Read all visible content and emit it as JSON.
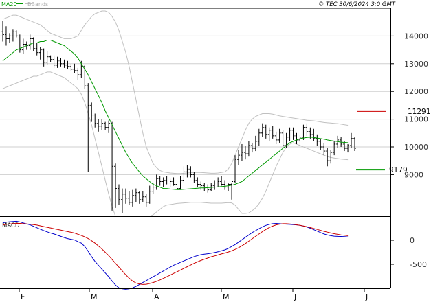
{
  "header": {
    "legend": [
      {
        "label": "MA20",
        "color": "#009900"
      },
      {
        "label": "BBands",
        "color": "#c0c0c0"
      }
    ],
    "copyright": "© TEC 30/6/2024 3:0 GMT"
  },
  "chart_data": [
    {
      "type": "ohlc",
      "ylim": [
        7500,
        15000
      ],
      "yticks": [
        9000,
        10000,
        11000,
        12000,
        13000,
        14000
      ],
      "ytick_labels": [
        "9000",
        "10000",
        "11000",
        "12000",
        "13000",
        "14000"
      ],
      "grid": true,
      "x_months": [
        "F",
        "M",
        "A",
        "M",
        "J",
        "J"
      ],
      "levels": [
        {
          "label": "11291",
          "value": 11291,
          "color": "#cc0000"
        },
        {
          "label": "9179",
          "value": 9179,
          "color": "#009900"
        }
      ],
      "ohlc": [
        [
          14150,
          14550,
          13800,
          14050
        ],
        [
          14050,
          14350,
          13650,
          13900
        ],
        [
          13900,
          14100,
          13750,
          14000
        ],
        [
          14000,
          14250,
          13800,
          14150
        ],
        [
          14150,
          14200,
          13950,
          14000
        ],
        [
          14000,
          14050,
          13400,
          13500
        ],
        [
          13500,
          13900,
          13350,
          13700
        ],
        [
          13700,
          13800,
          13500,
          13650
        ],
        [
          13650,
          14050,
          13500,
          13900
        ],
        [
          13900,
          13950,
          13450,
          13550
        ],
        [
          13550,
          13750,
          13300,
          13400
        ],
        [
          13400,
          13600,
          13150,
          13500
        ],
        [
          13500,
          13550,
          12900,
          13050
        ],
        [
          13050,
          13450,
          12950,
          13250
        ],
        [
          13250,
          13300,
          13050,
          13150
        ],
        [
          13150,
          13300,
          12850,
          12950
        ],
        [
          12950,
          13250,
          12850,
          13100
        ],
        [
          13100,
          13200,
          12900,
          13000
        ],
        [
          13000,
          13150,
          12850,
          12950
        ],
        [
          12950,
          13100,
          12800,
          12900
        ],
        [
          12900,
          13000,
          12750,
          12800
        ],
        [
          12800,
          13000,
          12650,
          12750
        ],
        [
          12750,
          12850,
          12400,
          12600
        ],
        [
          12600,
          13100,
          12500,
          12900
        ],
        [
          12900,
          12950,
          12100,
          12200
        ],
        [
          12200,
          12300,
          9100,
          11500
        ],
        [
          11500,
          11600,
          10900,
          11150
        ],
        [
          11150,
          11200,
          10700,
          10850
        ],
        [
          10850,
          11000,
          10550,
          10750
        ],
        [
          10750,
          11000,
          10600,
          10850
        ],
        [
          10850,
          10900,
          10600,
          10700
        ],
        [
          10700,
          10950,
          10500,
          10850
        ],
        [
          10850,
          10900,
          7700,
          9300
        ],
        [
          9300,
          9400,
          7800,
          8500
        ],
        [
          8500,
          8650,
          7900,
          8100
        ],
        [
          8100,
          8500,
          7600,
          8300
        ],
        [
          8300,
          8500,
          7950,
          8150
        ],
        [
          8150,
          8400,
          7900,
          8000
        ],
        [
          8000,
          8450,
          7850,
          8250
        ],
        [
          8250,
          8500,
          8000,
          8350
        ],
        [
          8350,
          8400,
          7950,
          8100
        ],
        [
          8100,
          8400,
          8000,
          8200
        ],
        [
          8200,
          8300,
          7850,
          8000
        ],
        [
          8000,
          8600,
          7950,
          8400
        ],
        [
          8400,
          8700,
          8300,
          8550
        ],
        [
          8550,
          9000,
          8450,
          8850
        ],
        [
          8850,
          8950,
          8600,
          8750
        ],
        [
          8750,
          8900,
          8550,
          8800
        ],
        [
          8800,
          8950,
          8650,
          8700
        ],
        [
          8700,
          8850,
          8550,
          8750
        ],
        [
          8750,
          8900,
          8600,
          8650
        ],
        [
          8650,
          8800,
          8400,
          8500
        ],
        [
          8500,
          8950,
          8450,
          8800
        ],
        [
          8800,
          9300,
          8700,
          9100
        ],
        [
          9100,
          9350,
          8900,
          9200
        ],
        [
          9200,
          9300,
          8900,
          9000
        ],
        [
          9000,
          9100,
          8700,
          8800
        ],
        [
          8800,
          8900,
          8550,
          8650
        ],
        [
          8650,
          8750,
          8450,
          8600
        ],
        [
          8600,
          8700,
          8400,
          8550
        ],
        [
          8550,
          8650,
          8350,
          8450
        ],
        [
          8450,
          8700,
          8400,
          8600
        ],
        [
          8600,
          8800,
          8450,
          8700
        ],
        [
          8700,
          8900,
          8550,
          8750
        ],
        [
          8750,
          8950,
          8600,
          8650
        ],
        [
          8650,
          8800,
          8450,
          8550
        ],
        [
          8550,
          8700,
          8400,
          8650
        ],
        [
          8650,
          8700,
          8100,
          8750
        ],
        [
          8750,
          9700,
          8700,
          9550
        ],
        [
          9550,
          9900,
          9350,
          9700
        ],
        [
          9700,
          10100,
          9500,
          9800
        ],
        [
          9800,
          10050,
          9550,
          9750
        ],
        [
          9750,
          10200,
          9650,
          10050
        ],
        [
          10050,
          10150,
          9800,
          9950
        ],
        [
          9950,
          10400,
          9850,
          10200
        ],
        [
          10200,
          10650,
          10050,
          10500
        ],
        [
          10500,
          10850,
          10350,
          10700
        ],
        [
          10700,
          10800,
          10300,
          10450
        ],
        [
          10450,
          10700,
          10200,
          10600
        ],
        [
          10600,
          10750,
          10300,
          10400
        ],
        [
          10400,
          10550,
          10100,
          10250
        ],
        [
          10250,
          10650,
          10150,
          10500
        ],
        [
          10500,
          10600,
          9950,
          10050
        ],
        [
          10050,
          10500,
          9950,
          10350
        ],
        [
          10350,
          10700,
          10200,
          10600
        ],
        [
          10600,
          10700,
          10250,
          10400
        ],
        [
          10400,
          10500,
          10100,
          10250
        ],
        [
          10250,
          10450,
          10050,
          10350
        ],
        [
          10350,
          10800,
          10250,
          10700
        ],
        [
          10700,
          10850,
          10400,
          10550
        ],
        [
          10550,
          10700,
          10300,
          10450
        ],
        [
          10450,
          10650,
          10200,
          10300
        ],
        [
          10300,
          10450,
          10050,
          10200
        ],
        [
          10200,
          10300,
          9900,
          10000
        ],
        [
          10000,
          10150,
          9700,
          9850
        ],
        [
          9850,
          9950,
          9300,
          9500
        ],
        [
          9500,
          9900,
          9400,
          9800
        ],
        [
          9800,
          10200,
          9700,
          10100
        ],
        [
          10100,
          10400,
          9950,
          10250
        ],
        [
          10250,
          10350,
          10000,
          10100
        ],
        [
          10100,
          10200,
          9850,
          9950
        ],
        [
          9950,
          10100,
          9800,
          10050
        ],
        [
          10050,
          10500,
          9950,
          10300
        ],
        [
          10300,
          10350,
          9850,
          9950
        ]
      ],
      "ma20": [
        13100,
        13200,
        13300,
        13400,
        13500,
        13550,
        13600,
        13650,
        13700,
        13750,
        13750,
        13800,
        13800,
        13850,
        13850,
        13800,
        13750,
        13700,
        13650,
        13550,
        13450,
        13350,
        13200,
        13000,
        12800,
        12600,
        12350,
        12100,
        11850,
        11600,
        11300,
        11050,
        10800,
        10550,
        10300,
        10050,
        9800,
        9600,
        9400,
        9250,
        9100,
        8950,
        8850,
        8750,
        8650,
        8600,
        8550,
        8500,
        8500,
        8480,
        8470,
        8460,
        8460,
        8470,
        8480,
        8490,
        8500,
        8510,
        8520,
        8520,
        8530,
        8540,
        8550,
        8560,
        8570,
        8580,
        8600,
        8620,
        8650,
        8700,
        8750,
        8850,
        8950,
        9050,
        9150,
        9250,
        9350,
        9450,
        9550,
        9650,
        9750,
        9850,
        9950,
        10050,
        10150,
        10200,
        10250,
        10300,
        10320,
        10340,
        10350,
        10340,
        10320,
        10300,
        10280,
        10250,
        10230,
        10210,
        10190,
        10170,
        10160,
        10150
      ],
      "bb_upper": [
        14600,
        14650,
        14700,
        14750,
        14750,
        14700,
        14650,
        14600,
        14550,
        14500,
        14450,
        14400,
        14300,
        14200,
        14100,
        14050,
        14000,
        13950,
        13900,
        13900,
        13900,
        13950,
        14000,
        14200,
        14400,
        14550,
        14700,
        14800,
        14850,
        14900,
        14900,
        14850,
        14700,
        14500,
        14200,
        13800,
        13400,
        12900,
        12300,
        11700,
        11100,
        10500,
        10000,
        9700,
        9400,
        9250,
        9150,
        9100,
        9080,
        9060,
        9050,
        9040,
        9040,
        9050,
        9060,
        9070,
        9080,
        9080,
        9080,
        9070,
        9060,
        9050,
        9050,
        9060,
        9080,
        9100,
        9200,
        9400,
        9700,
        10000,
        10300,
        10600,
        10850,
        11000,
        11100,
        11150,
        11200,
        11200,
        11200,
        11180,
        11150,
        11120,
        11100,
        11080,
        11060,
        11040,
        11020,
        11000,
        10980,
        10960,
        10950,
        10940,
        10920,
        10900,
        10880,
        10870,
        10860,
        10850,
        10840,
        10820,
        10800,
        10780
      ],
      "bb_lower": [
        12100,
        12150,
        12200,
        12250,
        12300,
        12350,
        12400,
        12450,
        12500,
        12550,
        12550,
        12600,
        12650,
        12700,
        12700,
        12650,
        12600,
        12550,
        12500,
        12400,
        12300,
        12200,
        12100,
        11900,
        11600,
        11200,
        10800,
        10300,
        9800,
        9300,
        8800,
        8300,
        7850,
        7500,
        7500,
        7500,
        7500,
        7500,
        7500,
        7500,
        7500,
        7500,
        7500,
        7500,
        7550,
        7650,
        7750,
        7850,
        7900,
        7920,
        7940,
        7960,
        7970,
        7980,
        7990,
        8000,
        8000,
        8000,
        8000,
        7990,
        7980,
        7970,
        7970,
        7970,
        7970,
        7980,
        7990,
        7980,
        7900,
        7750,
        7600,
        7600,
        7620,
        7700,
        7800,
        7950,
        8150,
        8400,
        8700,
        9000,
        9300,
        9550,
        9800,
        10000,
        10100,
        10150,
        10100,
        10050,
        10000,
        9950,
        9900,
        9850,
        9800,
        9750,
        9700,
        9650,
        9620,
        9600,
        9580,
        9560,
        9550,
        9540
      ]
    },
    {
      "type": "line",
      "title": "MACD",
      "ylim": [
        -1000,
        500
      ],
      "yticks": [
        0,
        -500
      ],
      "ytick_labels": [
        "0",
        "-500"
      ],
      "series": [
        {
          "color": "#0000cc",
          "values": [
            360,
            375,
            385,
            390,
            395,
            380,
            360,
            340,
            320,
            290,
            260,
            230,
            200,
            175,
            150,
            130,
            105,
            80,
            55,
            35,
            20,
            5,
            -30,
            -60,
            -130,
            -230,
            -340,
            -440,
            -520,
            -600,
            -680,
            -760,
            -850,
            -930,
            -990,
            -1010,
            -1020,
            -1010,
            -990,
            -960,
            -920,
            -880,
            -840,
            -800,
            -760,
            -720,
            -680,
            -640,
            -600,
            -560,
            -520,
            -490,
            -460,
            -430,
            -400,
            -370,
            -340,
            -320,
            -300,
            -290,
            -280,
            -270,
            -255,
            -240,
            -220,
            -200,
            -170,
            -130,
            -90,
            -40,
            10,
            60,
            110,
            160,
            200,
            240,
            280,
            310,
            330,
            345,
            350,
            345,
            340,
            335,
            330,
            325,
            320,
            310,
            295,
            275,
            250,
            220,
            190,
            160,
            130,
            110,
            95,
            85,
            80,
            78,
            76,
            70
          ]
        },
        {
          "color": "#cc0000",
          "values": [
            320,
            330,
            340,
            345,
            350,
            350,
            345,
            340,
            335,
            325,
            315,
            300,
            285,
            270,
            255,
            240,
            225,
            210,
            195,
            180,
            165,
            150,
            125,
            100,
            70,
            35,
            -10,
            -60,
            -120,
            -180,
            -250,
            -320,
            -400,
            -480,
            -560,
            -640,
            -720,
            -790,
            -850,
            -890,
            -910,
            -920,
            -915,
            -900,
            -880,
            -855,
            -825,
            -795,
            -760,
            -725,
            -690,
            -655,
            -620,
            -585,
            -550,
            -515,
            -480,
            -450,
            -420,
            -395,
            -370,
            -345,
            -325,
            -305,
            -285,
            -265,
            -245,
            -220,
            -190,
            -155,
            -115,
            -70,
            -20,
            30,
            80,
            130,
            180,
            225,
            265,
            295,
            320,
            335,
            345,
            345,
            340,
            332,
            322,
            310,
            296,
            281,
            264,
            246,
            226,
            206,
            186,
            168,
            151,
            136,
            123,
            112,
            103,
            95
          ]
        }
      ]
    }
  ]
}
